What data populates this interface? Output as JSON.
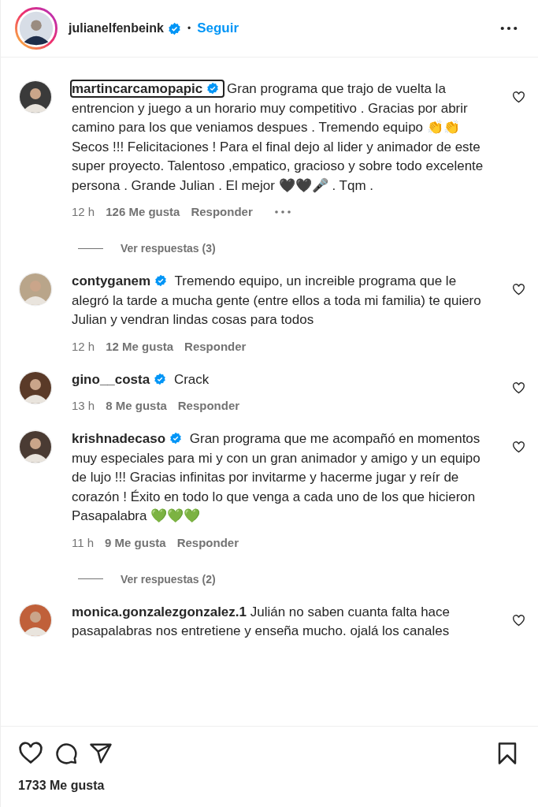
{
  "header": {
    "username": "julianelfenbeink",
    "verified": true,
    "separator": "•",
    "follow": "Seguir"
  },
  "comments": [
    {
      "username": "martincarcamopapic",
      "verified": true,
      "highlighted": true,
      "text": "Gran programa que trajo de vuelta la entrencion y juego a un horario muy competitivo . Gracias por abrir camino para los que veniamos despues . Tremendo equipo 👏👏 Secos !!! Felicitaciones ! Para el final dejo al lider y animador de este super proyecto. Talentoso ,empatico, gracioso y sobre todo excelente persona . Grande Julian . El mejor 🖤🖤🎤 . Tqm .",
      "time": "12 h",
      "likes": "126 Me gusta",
      "reply": "Responder",
      "more": true,
      "replies": "Ver respuestas (3)"
    },
    {
      "username": "contyganem",
      "verified": true,
      "highlighted": false,
      "text": "Tremendo equipo, un increible programa que le alegró la tarde a mucha gente (entre ellos a toda mi familia) te quiero Julian y vendran lindas cosas para todos",
      "time": "12 h",
      "likes": "12 Me gusta",
      "reply": "Responder",
      "more": false
    },
    {
      "username": "gino__costa",
      "verified": true,
      "highlighted": false,
      "text": "Crack",
      "time": "13 h",
      "likes": "8 Me gusta",
      "reply": "Responder",
      "more": false
    },
    {
      "username": "krishnadecaso",
      "verified": true,
      "highlighted": false,
      "text": "Gran programa que me acompañó en momentos muy especiales para mi y con un gran animador y amigo y un equipo de lujo !!! Gracias infinitas por invitarme y hacerme jugar y reír de corazón ! Éxito en todo lo que venga a cada uno de los que hicieron Pasapalabra 💚💚💚",
      "time": "11 h",
      "likes": "9 Me gusta",
      "reply": "Responder",
      "more": false,
      "replies": "Ver respuestas (2)"
    },
    {
      "username": "monica.gonzalezgonzalez.1",
      "verified": false,
      "highlighted": false,
      "text": "Julián no saben cuanta falta hace pasapalabras nos entretiene y enseña mucho. ojalá los canales"
    }
  ],
  "likes_total": "1733 Me gusta"
}
